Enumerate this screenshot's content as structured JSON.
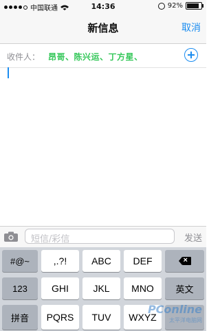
{
  "status_bar": {
    "carrier": "中国联通",
    "time": "14:36",
    "battery": "92%",
    "battery_level": 0.92
  },
  "nav": {
    "title": "新信息",
    "cancel_label": "取消"
  },
  "recipients": {
    "label": "收件人：",
    "names": "昂哥、陈兴运、丁方星、"
  },
  "input_bar": {
    "placeholder": "短信/彩信",
    "send_label": "发送"
  },
  "keyboard": {
    "row1": [
      "#@~",
      ",.?!",
      "ABC",
      "DEF"
    ],
    "row2": [
      "123",
      "GHI",
      "JKL",
      "MNO",
      "英文"
    ],
    "row3": [
      "拼音",
      "PQRS",
      "TUV",
      "WXYZ"
    ]
  },
  "watermark": {
    "brand": "PConline",
    "sub": "太平洋电脑网"
  }
}
